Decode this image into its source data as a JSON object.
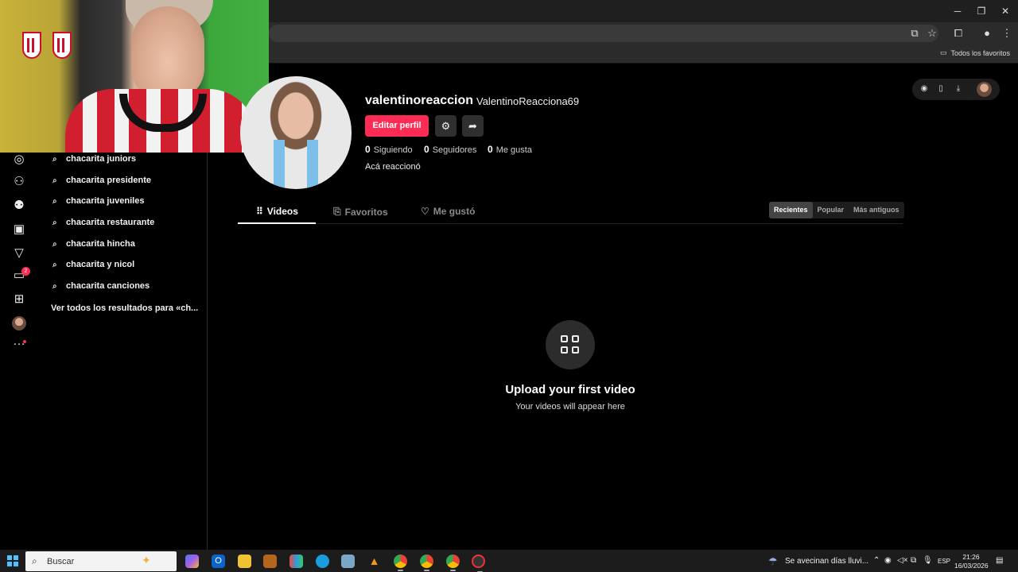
{
  "browser": {
    "bookmarks_folder": "Todos los favoritos",
    "controls": {
      "minimize": "─",
      "restore": "❐",
      "close": "✕"
    }
  },
  "sidebar": {
    "search_suggestions": [
      "chacarita juniors",
      "chacarita presidente",
      "chacarita juveniles",
      "chacarita restaurante",
      "chacarita hincha",
      "chacarita y nicol",
      "chacarita canciones"
    ],
    "see_all": "Ver todos los resultados para «ch...",
    "messages_badge": "2"
  },
  "profile": {
    "username": "valentinoreaccion",
    "nickname": "ValentinoReacciona69",
    "edit_button": "Editar perfil",
    "following_count": "0",
    "following_label": "Siguiendo",
    "followers_count": "0",
    "followers_label": "Seguidores",
    "likes_count": "0",
    "likes_label": "Me gusta",
    "bio": "Acá reaccionó"
  },
  "tabs": [
    {
      "label": "Videos",
      "active": true
    },
    {
      "label": "Favoritos",
      "active": false
    },
    {
      "label": "Me gustó",
      "active": false
    }
  ],
  "sort_options": [
    {
      "label": "Recientes",
      "active": true
    },
    {
      "label": "Popular",
      "active": false
    },
    {
      "label": "Más antiguos",
      "active": false
    }
  ],
  "empty_state": {
    "title": "Upload your first video",
    "subtitle": "Your videos will appear here"
  },
  "taskbar": {
    "search_label": "Buscar",
    "weather_text": "Se avecinan días lluvi...",
    "language": "ESP",
    "time": "21:26",
    "date": "16/03/2026"
  },
  "colors": {
    "accent": "#fe2c55",
    "background": "#000000",
    "chrome": "#2b2b2b"
  }
}
